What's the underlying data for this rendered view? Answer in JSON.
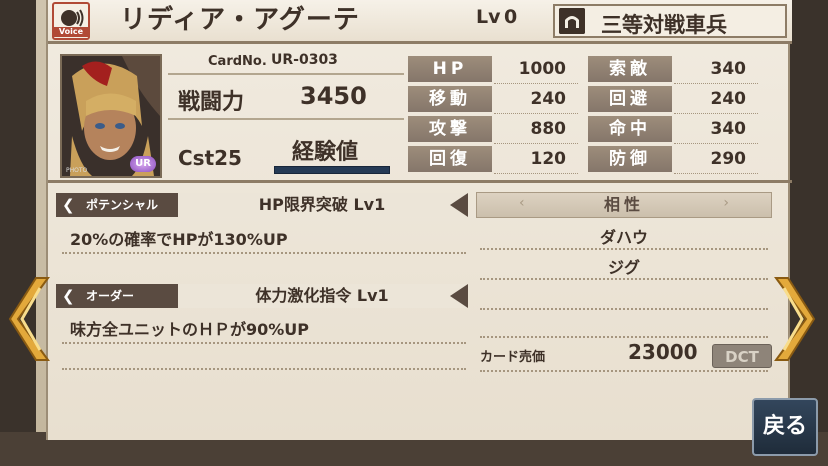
{
  "header": {
    "voice_label": "Voice",
    "name": "リディア・アグーテ",
    "lv_label": "Lv",
    "lv_value": "0",
    "class_name": "三等対戦車兵"
  },
  "card": {
    "no_label": "CardNo.",
    "no_value": "UR-0303",
    "power_label": "戦闘力",
    "power_value": "3450",
    "cost": "Cst25",
    "exp_label": "経験値",
    "rarity": "UR",
    "photo_label": "PHOTO"
  },
  "stats_left": [
    {
      "label": "HP",
      "value": "1000"
    },
    {
      "label": "移動",
      "value": "240"
    },
    {
      "label": "攻撃",
      "value": "880"
    },
    {
      "label": "回復",
      "value": "120"
    }
  ],
  "stats_right": [
    {
      "label": "索敵",
      "value": "340"
    },
    {
      "label": "回避",
      "value": "240"
    },
    {
      "label": "命中",
      "value": "340"
    },
    {
      "label": "防御",
      "value": "290"
    }
  ],
  "potential": {
    "tag": "ポテンシャル",
    "title": "HP限界突破 Lv1",
    "desc": "20%の確率でHPが130%UP"
  },
  "order": {
    "tag": "オーダー",
    "title": "体力激化指令 Lv1",
    "desc": "味方全ユニットのＨＰが90%UP"
  },
  "affinity": {
    "title": "相性",
    "items": [
      "ダハウ",
      "ジグ"
    ]
  },
  "sale": {
    "label": "カード売価",
    "value": "23000",
    "currency": "DCT"
  },
  "back_label": "戻る",
  "colors": {
    "accent_red": "#b14a36",
    "stat_label_bg": "#9d8d7b",
    "back_btn": "#2a3b4e",
    "arrow_gold": "#e3a93b"
  }
}
